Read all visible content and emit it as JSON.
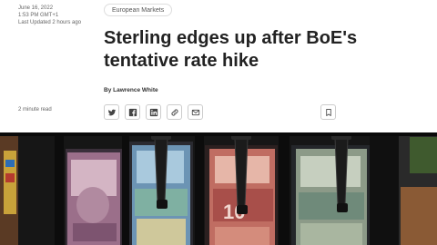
{
  "article": {
    "date": "June 16, 2022",
    "time": "1:53 PM GMT+1",
    "updated": "Last Updated 2 hours ago",
    "section": "European Markets",
    "headline": "Sterling edges up after BoE's tentative rate hike",
    "byline": "By Lawrence White",
    "read_time": "2 minute read"
  },
  "share": {
    "buttons": [
      "twitter-icon",
      "facebook-icon",
      "linkedin-icon",
      "link-icon",
      "email-icon"
    ],
    "bookmark": "bookmark-icon"
  },
  "photo": {
    "note_label": "10"
  }
}
